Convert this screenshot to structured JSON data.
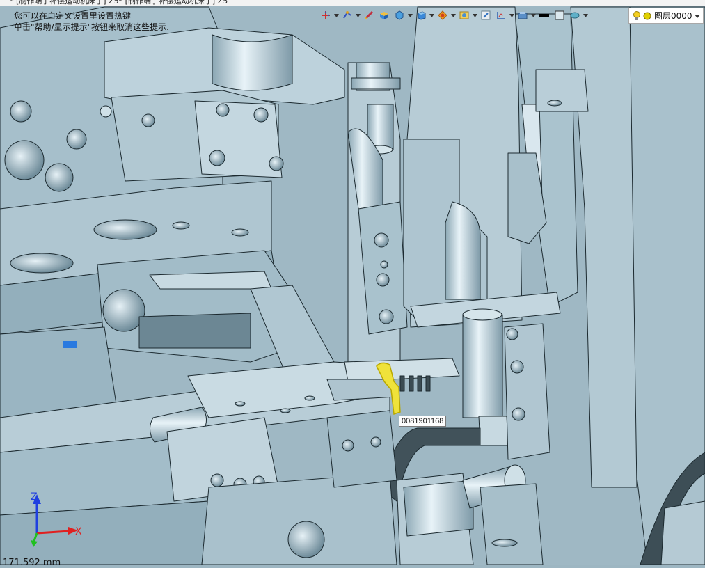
{
  "window": {
    "tab_text": "* [制作端子补偿运动机床子] Z5* [制作端子补偿运动机床子] Z5"
  },
  "hints": {
    "line1": "您可以在自定义设置里设置热键",
    "line2": "单击\"帮助/显示提示\"按钮来取消这些提示."
  },
  "toolbar": {
    "icons": [
      "move-icon",
      "transform-icon",
      "measure-icon",
      "solid-icon",
      "surface-icon",
      "box-icon",
      "render-icon",
      "view-icon",
      "section-icon",
      "layer-manager-icon",
      "color-black-icon",
      "color-frame-icon",
      "display-mode-icon"
    ]
  },
  "layer": {
    "name": "图层0000",
    "bulb_color": "#f5d020",
    "dot_color": "#e0d000"
  },
  "selection": {
    "tooltip": "0081901168",
    "highlight_color": "#f0e020"
  },
  "triad": {
    "x_label": "X",
    "z_label": "Z",
    "x_color": "#e02020",
    "y_color": "#20c020",
    "z_color": "#2040e0"
  },
  "status": {
    "coord_text": "171.592 mm"
  }
}
